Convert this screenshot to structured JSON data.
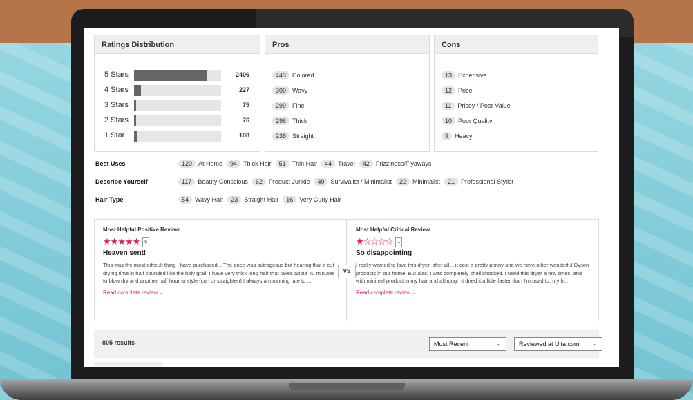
{
  "ratings": {
    "title": "Ratings Distribution",
    "rows": [
      {
        "label": "5 Stars",
        "count": "2406",
        "fill": 0.83
      },
      {
        "label": "4 Stars",
        "count": "227",
        "fill": 0.08
      },
      {
        "label": "3 Stars",
        "count": "75",
        "fill": 0.025
      },
      {
        "label": "2 Stars",
        "count": "76",
        "fill": 0.025
      },
      {
        "label": "1 Star",
        "count": "108",
        "fill": 0.035
      }
    ]
  },
  "pros": {
    "title": "Pros",
    "items": [
      {
        "count": "443",
        "label": "Colored"
      },
      {
        "count": "309",
        "label": "Wavy"
      },
      {
        "count": "299",
        "label": "Fine"
      },
      {
        "count": "296",
        "label": "Thick"
      },
      {
        "count": "238",
        "label": "Straight"
      }
    ]
  },
  "cons": {
    "title": "Cons",
    "items": [
      {
        "count": "13",
        "label": "Expensive"
      },
      {
        "count": "12",
        "label": "Price"
      },
      {
        "count": "11",
        "label": "Pricey / Poor Value"
      },
      {
        "count": "10",
        "label": "Poor Quality"
      },
      {
        "count": "9",
        "label": "Heavy"
      }
    ]
  },
  "attributes": [
    {
      "label": "Best Uses",
      "values": [
        {
          "count": "120",
          "label": "At Home"
        },
        {
          "count": "94",
          "label": "Thick Hair"
        },
        {
          "count": "51",
          "label": "Thin Hair"
        },
        {
          "count": "44",
          "label": "Travel"
        },
        {
          "count": "42",
          "label": "Frizziness/Flyaways"
        }
      ]
    },
    {
      "label": "Describe Yourself",
      "values": [
        {
          "count": "117",
          "label": "Beauty Conscious"
        },
        {
          "count": "62",
          "label": "Product Junkie"
        },
        {
          "count": "49",
          "label": "Survivalist / Minimalist"
        },
        {
          "count": "22",
          "label": "Minimalist"
        },
        {
          "count": "21",
          "label": "Professional Stylist"
        }
      ]
    },
    {
      "label": "Hair Type",
      "values": [
        {
          "count": "54",
          "label": "Wavy Hair"
        },
        {
          "count": "23",
          "label": "Straight Hair"
        },
        {
          "count": "16",
          "label": "Very Curly Hair"
        }
      ]
    }
  ],
  "positive_review": {
    "kicker": "Most Helpful Positive Review",
    "rating": 5,
    "rating_badge": "5",
    "title": "Heaven sent!",
    "body": "This was the most difficult thing I have purchased... The price was outrageous but hearing that it cut drying time in half sounded like the holy grail. I have very thick long hair that takes about 40 minutes to blow dry and another half hour to style (curl or straighten) I always am running late to ...",
    "link": "Read complete review"
  },
  "critical_review": {
    "kicker": "Most Helpful Critical Review",
    "rating": 1,
    "rating_badge": "1",
    "title": "So disappointing",
    "body": "I really wanted to love this dryer, after all....it cost a pretty penny and we have other wonderful Dyson products in our home. But alas, I was completely shell shocked. I used this dryer a few times, and with minimal product in my hair and although it dried it a little faster than I'm used to, my h...",
    "link": "Read complete review"
  },
  "vs_label": "VS",
  "results": {
    "count": "805 results",
    "sort_value": "Most Recent",
    "filter_value": "Reviewed at Ulta.com"
  },
  "colors": {
    "accent": "#e5185c",
    "bar": "#666666",
    "brand_bg_top": "#b5744a",
    "bg": "#8fd3df"
  },
  "icons": {
    "chevron": "chevron-down-icon",
    "star": "star-icon"
  }
}
